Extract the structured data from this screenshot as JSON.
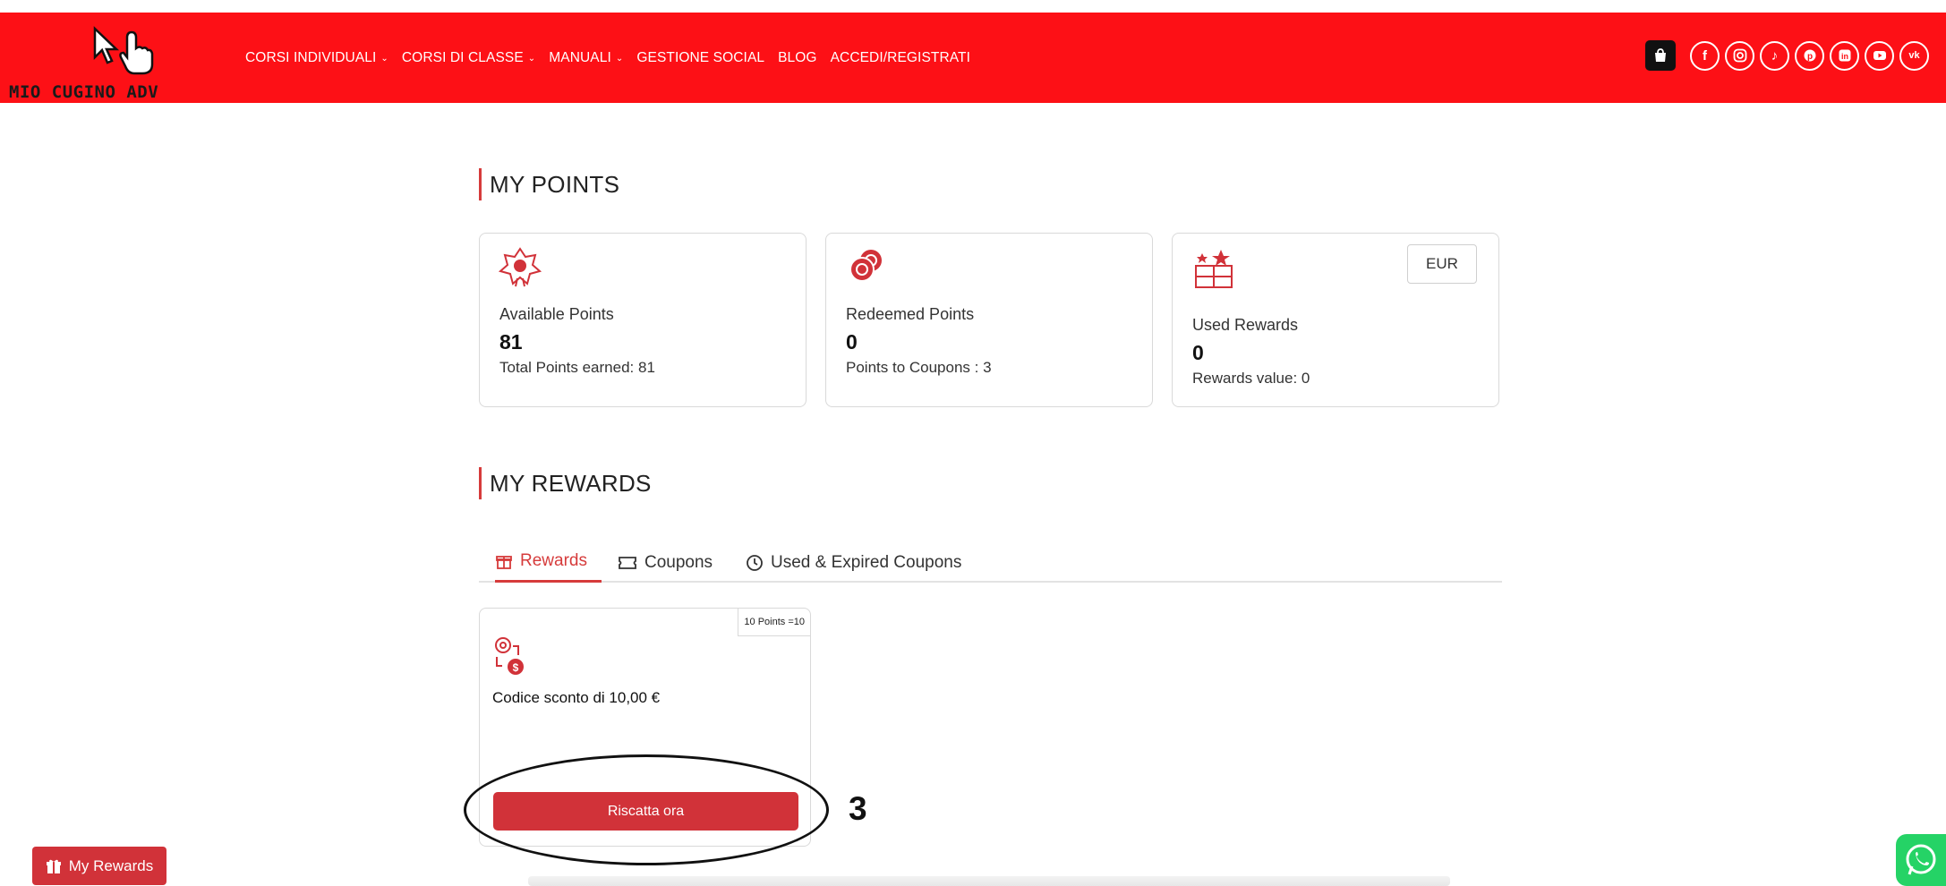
{
  "header": {
    "logo_text": "MIO CUGINO ADV",
    "nav": [
      {
        "label": "CORSI INDIVIDUALI",
        "chevron": true
      },
      {
        "label": "CORSI DI CLASSE",
        "chevron": true
      },
      {
        "label": "MANUALI",
        "chevron": true
      },
      {
        "label": "GESTIONE SOCIAL",
        "chevron": false
      },
      {
        "label": "BLOG",
        "chevron": false
      },
      {
        "label": "ACCEDI/REGISTRATI",
        "chevron": false
      }
    ],
    "social_icons": [
      "facebook-icon",
      "instagram-icon",
      "tiktok-icon",
      "pinterest-icon",
      "linkedin-icon",
      "youtube-icon",
      "vk-icon"
    ],
    "brand_color": "#fd1016"
  },
  "points": {
    "title": "MY POINTS",
    "available": {
      "label": "Available Points",
      "value": "81",
      "sub": "Total Points earned: 81"
    },
    "redeemed": {
      "label": "Redeemed Points",
      "value": "0",
      "sub": "Points to Coupons : 3"
    },
    "used": {
      "label": "Used Rewards",
      "value": "0",
      "sub": "Rewards value: 0",
      "currency": "EUR"
    }
  },
  "rewards": {
    "title": "MY REWARDS",
    "tabs": [
      {
        "label": "Rewards",
        "active": true
      },
      {
        "label": "Coupons",
        "active": false
      },
      {
        "label": "Used & Expired Coupons",
        "active": false
      }
    ],
    "card": {
      "ribbon": "10 Points =10",
      "title": "Codice sconto di 10,00 €",
      "button": "Riscatta ora"
    }
  },
  "annotation": {
    "step_number": "3"
  },
  "floating": {
    "my_rewards_label": "My Rewards"
  },
  "accent_color": "#d13239"
}
